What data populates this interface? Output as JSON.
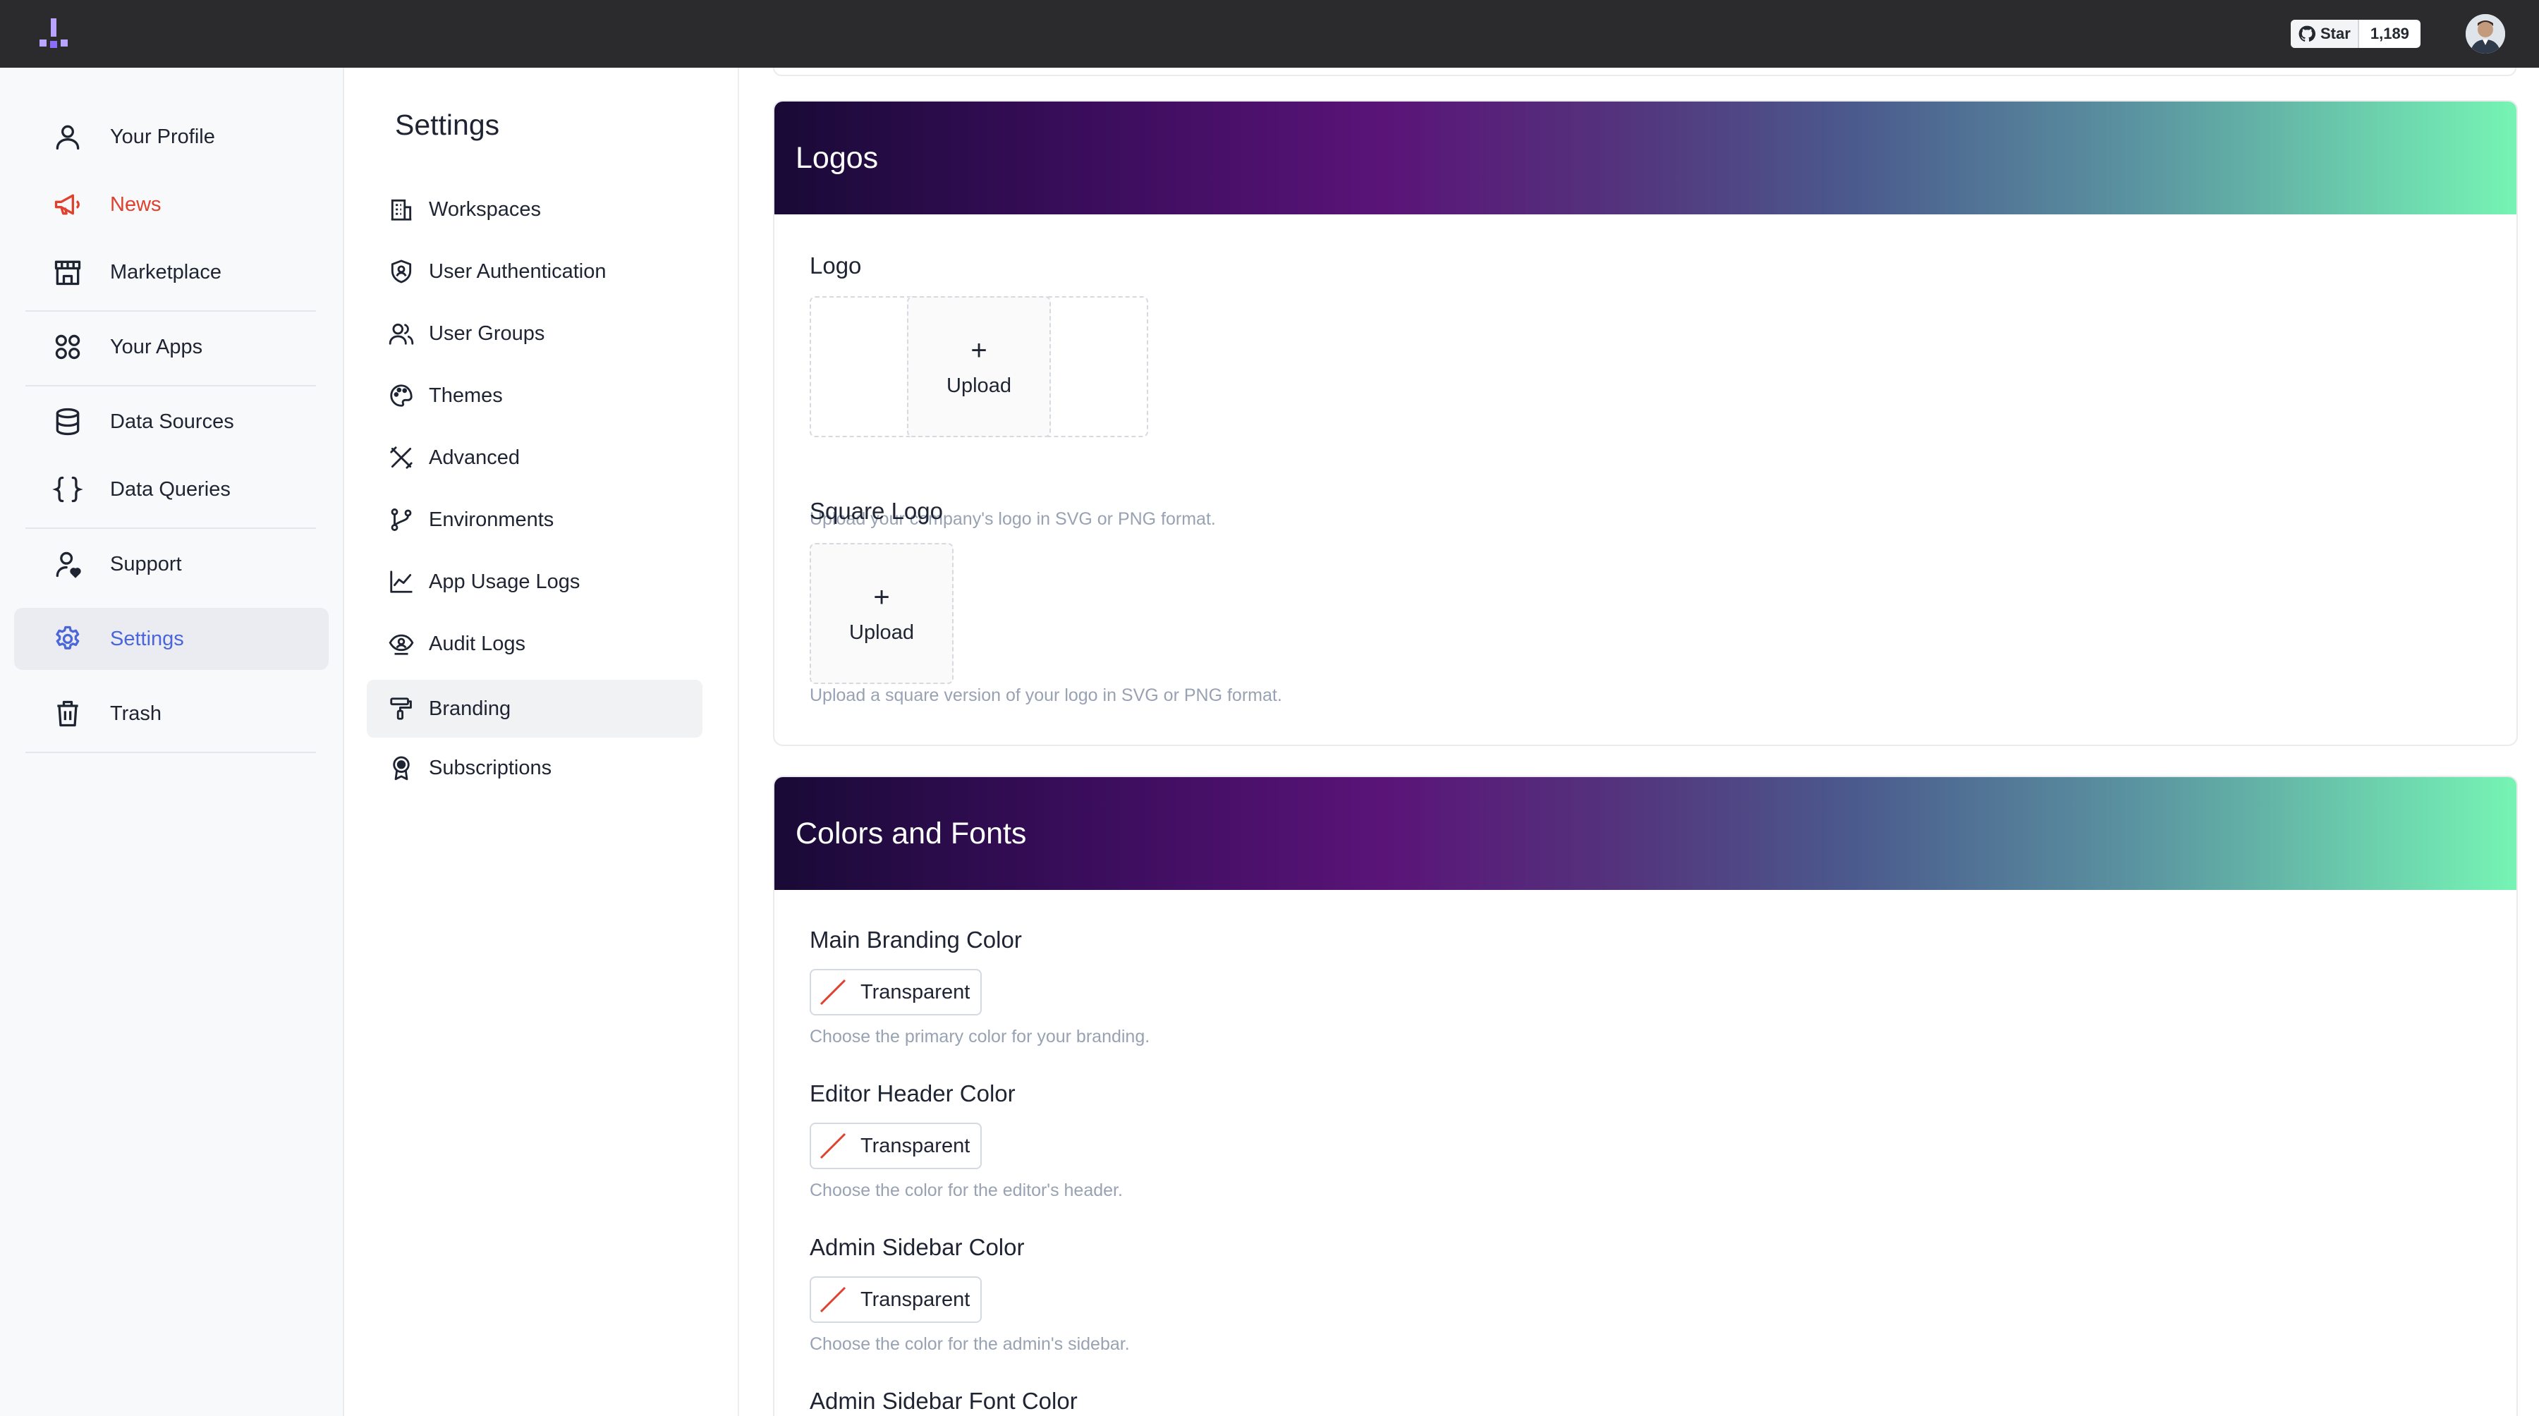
{
  "github": {
    "star_label": "Star",
    "star_count": "1,189"
  },
  "nav": {
    "items": [
      {
        "label": "Your Profile"
      },
      {
        "label": "News"
      },
      {
        "label": "Marketplace"
      },
      {
        "label": "Your Apps"
      },
      {
        "label": "Data Sources"
      },
      {
        "label": "Data Queries"
      },
      {
        "label": "Support"
      },
      {
        "label": "Settings"
      },
      {
        "label": "Trash"
      }
    ],
    "active": "Settings",
    "highlight": "News"
  },
  "settings": {
    "title": "Settings",
    "items": [
      {
        "label": "Workspaces",
        "icon": "building-icon"
      },
      {
        "label": "User Authentication",
        "icon": "shield-user-icon"
      },
      {
        "label": "User Groups",
        "icon": "users-icon"
      },
      {
        "label": "Themes",
        "icon": "palette-icon"
      },
      {
        "label": "Advanced",
        "icon": "tools-icon"
      },
      {
        "label": "Environments",
        "icon": "git-branch-icon"
      },
      {
        "label": "App Usage Logs",
        "icon": "line-chart-icon"
      },
      {
        "label": "Audit Logs",
        "icon": "eye-user-icon"
      },
      {
        "label": "Branding",
        "icon": "paint-roller-icon"
      },
      {
        "label": "Subscriptions",
        "icon": "badge-icon"
      }
    ],
    "active": "Branding"
  },
  "logos": {
    "header": "Logos",
    "logo_title": "Logo",
    "logo_upload": "Upload",
    "logo_hint": "Upload your company's logo in SVG or PNG format.",
    "square_title": "Square Logo",
    "square_upload": "Upload",
    "square_hint": "Upload a square version of your logo in SVG or PNG format."
  },
  "colors": {
    "header": "Colors and Fonts",
    "fields": [
      {
        "title": "Main Branding Color",
        "value": "Transparent",
        "hint": "Choose the primary color for your branding."
      },
      {
        "title": "Editor Header Color",
        "value": "Transparent",
        "hint": "Choose the color for the editor's header."
      },
      {
        "title": "Admin Sidebar Color",
        "value": "Transparent",
        "hint": "Choose the color for the admin's sidebar."
      },
      {
        "title": "Admin Sidebar Font Color"
      }
    ]
  },
  "theme": {
    "accent": "#4a66d8",
    "news": "#e0402e",
    "topbar": "#2b2b2e"
  }
}
